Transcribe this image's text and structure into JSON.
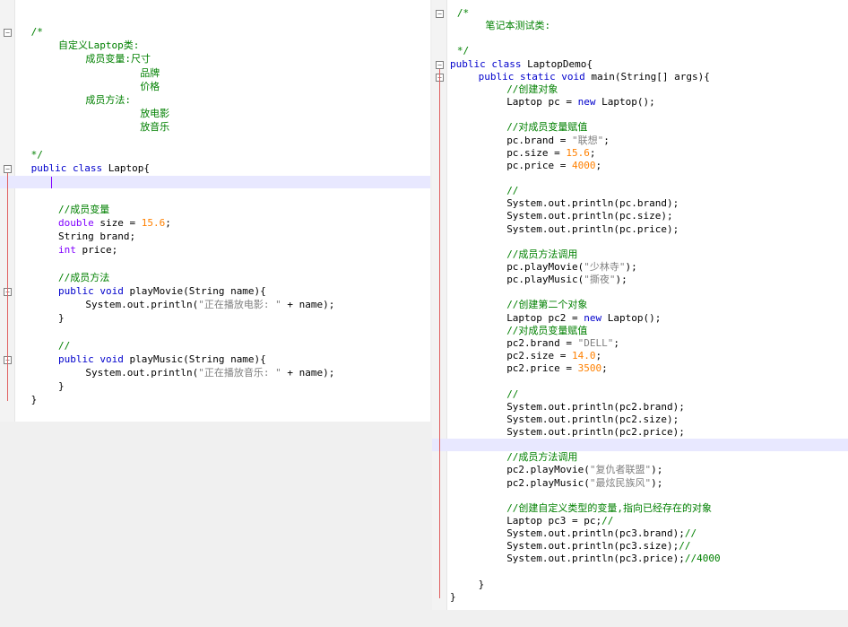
{
  "left": {
    "lines": [
      {
        "row": 0,
        "indent": 1,
        "spans": [
          {
            "t": "/*",
            "c": "cm"
          }
        ]
      },
      {
        "row": 1,
        "indent": 5,
        "spans": [
          {
            "t": "自定义Laptop类:",
            "c": "cm"
          }
        ]
      },
      {
        "row": 2,
        "indent": 9,
        "spans": [
          {
            "t": "成员变量:尺寸",
            "c": "cm"
          }
        ]
      },
      {
        "row": 3,
        "indent": 17,
        "spans": [
          {
            "t": "品牌",
            "c": "cm"
          }
        ]
      },
      {
        "row": 4,
        "indent": 17,
        "spans": [
          {
            "t": "价格",
            "c": "cm"
          }
        ]
      },
      {
        "row": 5,
        "indent": 9,
        "spans": [
          {
            "t": "成员方法:",
            "c": "cm"
          }
        ]
      },
      {
        "row": 6,
        "indent": 17,
        "spans": [
          {
            "t": "放电影",
            "c": "cm"
          }
        ]
      },
      {
        "row": 7,
        "indent": 17,
        "spans": [
          {
            "t": "放音乐",
            "c": "cm"
          }
        ]
      },
      {
        "row": 8,
        "indent": 1,
        "spans": []
      },
      {
        "row": 9,
        "indent": 1,
        "spans": [
          {
            "t": "*/",
            "c": "cm"
          }
        ]
      },
      {
        "row": 10,
        "indent": 1,
        "spans": [
          {
            "t": "public class ",
            "c": "kw"
          },
          {
            "t": "Laptop{",
            "c": ""
          }
        ]
      },
      {
        "row": 11,
        "indent": 1,
        "spans": []
      },
      {
        "row": 12,
        "indent": 1,
        "spans": []
      },
      {
        "row": 13,
        "indent": 5,
        "spans": [
          {
            "t": "//成员变量",
            "c": "cm"
          }
        ]
      },
      {
        "row": 14,
        "indent": 5,
        "spans": [
          {
            "t": "double",
            "c": "kt"
          },
          {
            "t": " size = ",
            "c": ""
          },
          {
            "t": "15.6",
            "c": "num"
          },
          {
            "t": ";",
            "c": ""
          }
        ]
      },
      {
        "row": 15,
        "indent": 5,
        "spans": [
          {
            "t": "String brand;",
            "c": ""
          }
        ]
      },
      {
        "row": 16,
        "indent": 5,
        "spans": [
          {
            "t": "int",
            "c": "kt"
          },
          {
            "t": " price;",
            "c": ""
          }
        ]
      },
      {
        "row": 17,
        "indent": 1,
        "spans": []
      },
      {
        "row": 18,
        "indent": 5,
        "spans": [
          {
            "t": "//成员方法",
            "c": "cm"
          }
        ]
      },
      {
        "row": 19,
        "indent": 5,
        "spans": [
          {
            "t": "public void",
            "c": "kw"
          },
          {
            "t": " playMovie(String name){",
            "c": ""
          }
        ]
      },
      {
        "row": 20,
        "indent": 9,
        "spans": [
          {
            "t": "System.out.println(",
            "c": ""
          },
          {
            "t": "\"正在播放电影: \"",
            "c": "str"
          },
          {
            "t": " + name);",
            "c": ""
          }
        ]
      },
      {
        "row": 21,
        "indent": 5,
        "spans": [
          {
            "t": "}",
            "c": ""
          }
        ]
      },
      {
        "row": 22,
        "indent": 1,
        "spans": []
      },
      {
        "row": 23,
        "indent": 5,
        "spans": [
          {
            "t": "//",
            "c": "cm"
          }
        ]
      },
      {
        "row": 24,
        "indent": 5,
        "spans": [
          {
            "t": "public void",
            "c": "kw"
          },
          {
            "t": " playMusic(String name){",
            "c": ""
          }
        ]
      },
      {
        "row": 25,
        "indent": 9,
        "spans": [
          {
            "t": "System.out.println(",
            "c": ""
          },
          {
            "t": "\"正在播放音乐: \"",
            "c": "str"
          },
          {
            "t": " + name);",
            "c": ""
          }
        ]
      },
      {
        "row": 26,
        "indent": 5,
        "spans": [
          {
            "t": "}",
            "c": ""
          }
        ]
      },
      {
        "row": 27,
        "indent": 1,
        "spans": [
          {
            "t": "}",
            "c": ""
          }
        ]
      }
    ]
  },
  "right": {
    "lines": [
      {
        "row": 0,
        "indent": 1,
        "spans": [
          {
            "t": "/*",
            "c": "cm"
          }
        ]
      },
      {
        "row": 1,
        "indent": 5,
        "spans": [
          {
            "t": "笔记本测试类:",
            "c": "cm"
          }
        ]
      },
      {
        "row": 2,
        "indent": 1,
        "spans": []
      },
      {
        "row": 3,
        "indent": 1,
        "spans": [
          {
            "t": "*/",
            "c": "cm"
          }
        ]
      },
      {
        "row": 4,
        "indent": 0,
        "spans": [
          {
            "t": "public class ",
            "c": "kw"
          },
          {
            "t": "LaptopDemo{",
            "c": ""
          }
        ]
      },
      {
        "row": 5,
        "indent": 4,
        "spans": [
          {
            "t": "public static void",
            "c": "kw"
          },
          {
            "t": " main(String[] args){",
            "c": ""
          }
        ]
      },
      {
        "row": 6,
        "indent": 8,
        "spans": [
          {
            "t": "//创建对象",
            "c": "cm"
          }
        ]
      },
      {
        "row": 7,
        "indent": 8,
        "spans": [
          {
            "t": "Laptop pc = ",
            "c": ""
          },
          {
            "t": "new",
            "c": "kw"
          },
          {
            "t": " Laptop();",
            "c": ""
          }
        ]
      },
      {
        "row": 8,
        "indent": 0,
        "spans": []
      },
      {
        "row": 9,
        "indent": 8,
        "spans": [
          {
            "t": "//对成员变量赋值",
            "c": "cm"
          }
        ]
      },
      {
        "row": 10,
        "indent": 8,
        "spans": [
          {
            "t": "pc.brand = ",
            "c": ""
          },
          {
            "t": "\"联想\"",
            "c": "str"
          },
          {
            "t": ";",
            "c": ""
          }
        ]
      },
      {
        "row": 11,
        "indent": 8,
        "spans": [
          {
            "t": "pc.size = ",
            "c": ""
          },
          {
            "t": "15.6",
            "c": "num"
          },
          {
            "t": ";",
            "c": ""
          }
        ]
      },
      {
        "row": 12,
        "indent": 8,
        "spans": [
          {
            "t": "pc.price = ",
            "c": ""
          },
          {
            "t": "4000",
            "c": "num"
          },
          {
            "t": ";",
            "c": ""
          }
        ]
      },
      {
        "row": 13,
        "indent": 0,
        "spans": []
      },
      {
        "row": 14,
        "indent": 8,
        "spans": [
          {
            "t": "//",
            "c": "cm"
          }
        ]
      },
      {
        "row": 15,
        "indent": 8,
        "spans": [
          {
            "t": "System.out.println(pc.brand);",
            "c": ""
          }
        ]
      },
      {
        "row": 16,
        "indent": 8,
        "spans": [
          {
            "t": "System.out.println(pc.size);",
            "c": ""
          }
        ]
      },
      {
        "row": 17,
        "indent": 8,
        "spans": [
          {
            "t": "System.out.println(pc.price);",
            "c": ""
          }
        ]
      },
      {
        "row": 18,
        "indent": 0,
        "spans": []
      },
      {
        "row": 19,
        "indent": 8,
        "spans": [
          {
            "t": "//成员方法调用",
            "c": "cm"
          }
        ]
      },
      {
        "row": 20,
        "indent": 8,
        "spans": [
          {
            "t": "pc.playMovie(",
            "c": ""
          },
          {
            "t": "\"少林寺\"",
            "c": "str"
          },
          {
            "t": ");",
            "c": ""
          }
        ]
      },
      {
        "row": 21,
        "indent": 8,
        "spans": [
          {
            "t": "pc.playMusic(",
            "c": ""
          },
          {
            "t": "\"撕夜\"",
            "c": "str"
          },
          {
            "t": ");",
            "c": ""
          }
        ]
      },
      {
        "row": 22,
        "indent": 0,
        "spans": []
      },
      {
        "row": 23,
        "indent": 8,
        "spans": [
          {
            "t": "//创建第二个对象",
            "c": "cm"
          }
        ]
      },
      {
        "row": 24,
        "indent": 8,
        "spans": [
          {
            "t": "Laptop pc2 = ",
            "c": ""
          },
          {
            "t": "new",
            "c": "kw"
          },
          {
            "t": " Laptop();",
            "c": ""
          }
        ]
      },
      {
        "row": 25,
        "indent": 8,
        "spans": [
          {
            "t": "//对成员变量赋值",
            "c": "cm"
          }
        ]
      },
      {
        "row": 26,
        "indent": 8,
        "spans": [
          {
            "t": "pc2.brand = ",
            "c": ""
          },
          {
            "t": "\"DELL\"",
            "c": "str"
          },
          {
            "t": ";",
            "c": ""
          }
        ]
      },
      {
        "row": 27,
        "indent": 8,
        "spans": [
          {
            "t": "pc2.size = ",
            "c": ""
          },
          {
            "t": "14.0",
            "c": "num"
          },
          {
            "t": ";",
            "c": ""
          }
        ]
      },
      {
        "row": 28,
        "indent": 8,
        "spans": [
          {
            "t": "pc2.price = ",
            "c": ""
          },
          {
            "t": "3500",
            "c": "num"
          },
          {
            "t": ";",
            "c": ""
          }
        ]
      },
      {
        "row": 29,
        "indent": 0,
        "spans": []
      },
      {
        "row": 30,
        "indent": 8,
        "spans": [
          {
            "t": "//",
            "c": "cm"
          }
        ]
      },
      {
        "row": 31,
        "indent": 8,
        "spans": [
          {
            "t": "System.out.println(pc2.brand);",
            "c": ""
          }
        ]
      },
      {
        "row": 32,
        "indent": 8,
        "spans": [
          {
            "t": "System.out.println(pc2.size);",
            "c": ""
          }
        ]
      },
      {
        "row": 33,
        "indent": 8,
        "spans": [
          {
            "t": "System.out.println(pc2.price);",
            "c": ""
          }
        ]
      },
      {
        "row": 34,
        "indent": 0,
        "spans": []
      },
      {
        "row": 35,
        "indent": 8,
        "spans": [
          {
            "t": "//成员方法调用",
            "c": "cm"
          }
        ]
      },
      {
        "row": 36,
        "indent": 8,
        "spans": [
          {
            "t": "pc2.playMovie(",
            "c": ""
          },
          {
            "t": "\"复仇者联盟\"",
            "c": "str"
          },
          {
            "t": ");",
            "c": ""
          }
        ]
      },
      {
        "row": 37,
        "indent": 8,
        "spans": [
          {
            "t": "pc2.playMusic(",
            "c": ""
          },
          {
            "t": "\"最炫民族风\"",
            "c": "str"
          },
          {
            "t": ");",
            "c": ""
          }
        ]
      },
      {
        "row": 38,
        "indent": 0,
        "spans": []
      },
      {
        "row": 39,
        "indent": 8,
        "spans": [
          {
            "t": "//创建自定义类型的变量,指向已经存在的对象",
            "c": "cm"
          }
        ]
      },
      {
        "row": 40,
        "indent": 8,
        "spans": [
          {
            "t": "Laptop pc3 = pc;",
            "c": ""
          },
          {
            "t": "//",
            "c": "cm"
          }
        ]
      },
      {
        "row": 41,
        "indent": 8,
        "spans": [
          {
            "t": "System.out.println(pc3.brand);",
            "c": ""
          },
          {
            "t": "//",
            "c": "cm"
          }
        ]
      },
      {
        "row": 42,
        "indent": 8,
        "spans": [
          {
            "t": "System.out.println(pc3.size);",
            "c": ""
          },
          {
            "t": "//",
            "c": "cm"
          }
        ]
      },
      {
        "row": 43,
        "indent": 8,
        "spans": [
          {
            "t": "System.out.println(pc3.price);",
            "c": ""
          },
          {
            "t": "//4000",
            "c": "cm"
          }
        ]
      },
      {
        "row": 44,
        "indent": 0,
        "spans": []
      },
      {
        "row": 45,
        "indent": 4,
        "spans": [
          {
            "t": "}",
            "c": ""
          }
        ]
      },
      {
        "row": 46,
        "indent": 0,
        "spans": [
          {
            "t": "}",
            "c": ""
          }
        ]
      }
    ]
  }
}
